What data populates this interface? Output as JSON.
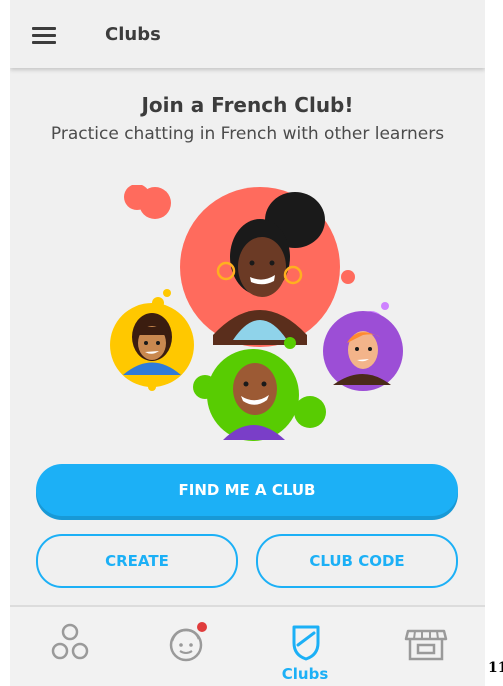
{
  "app_bar": {
    "title": "Clubs",
    "menu_icon": "hamburger-menu-icon"
  },
  "promo": {
    "headline": "Join a French Club!",
    "subtitle": "Practice chatting in French with other learners"
  },
  "buttons": {
    "find": "FIND ME A CLUB",
    "create": "CREATE",
    "club_code": "CLUB CODE"
  },
  "bottom_nav": {
    "items": [
      {
        "icon": "learn-circles-icon",
        "label": "",
        "active": false
      },
      {
        "icon": "profile-face-icon",
        "label": "",
        "active": false,
        "badge": true
      },
      {
        "icon": "clubs-shield-icon",
        "label": "Clubs",
        "active": true
      },
      {
        "icon": "shop-storefront-icon",
        "label": "",
        "active": false
      }
    ]
  },
  "edge_text": "11",
  "colors": {
    "accent": "#1cb0f6",
    "background": "#f0f0f0",
    "text": "#3c3c3c",
    "inactive_icon": "#9a9a9a",
    "badge": "#e03c3c"
  }
}
